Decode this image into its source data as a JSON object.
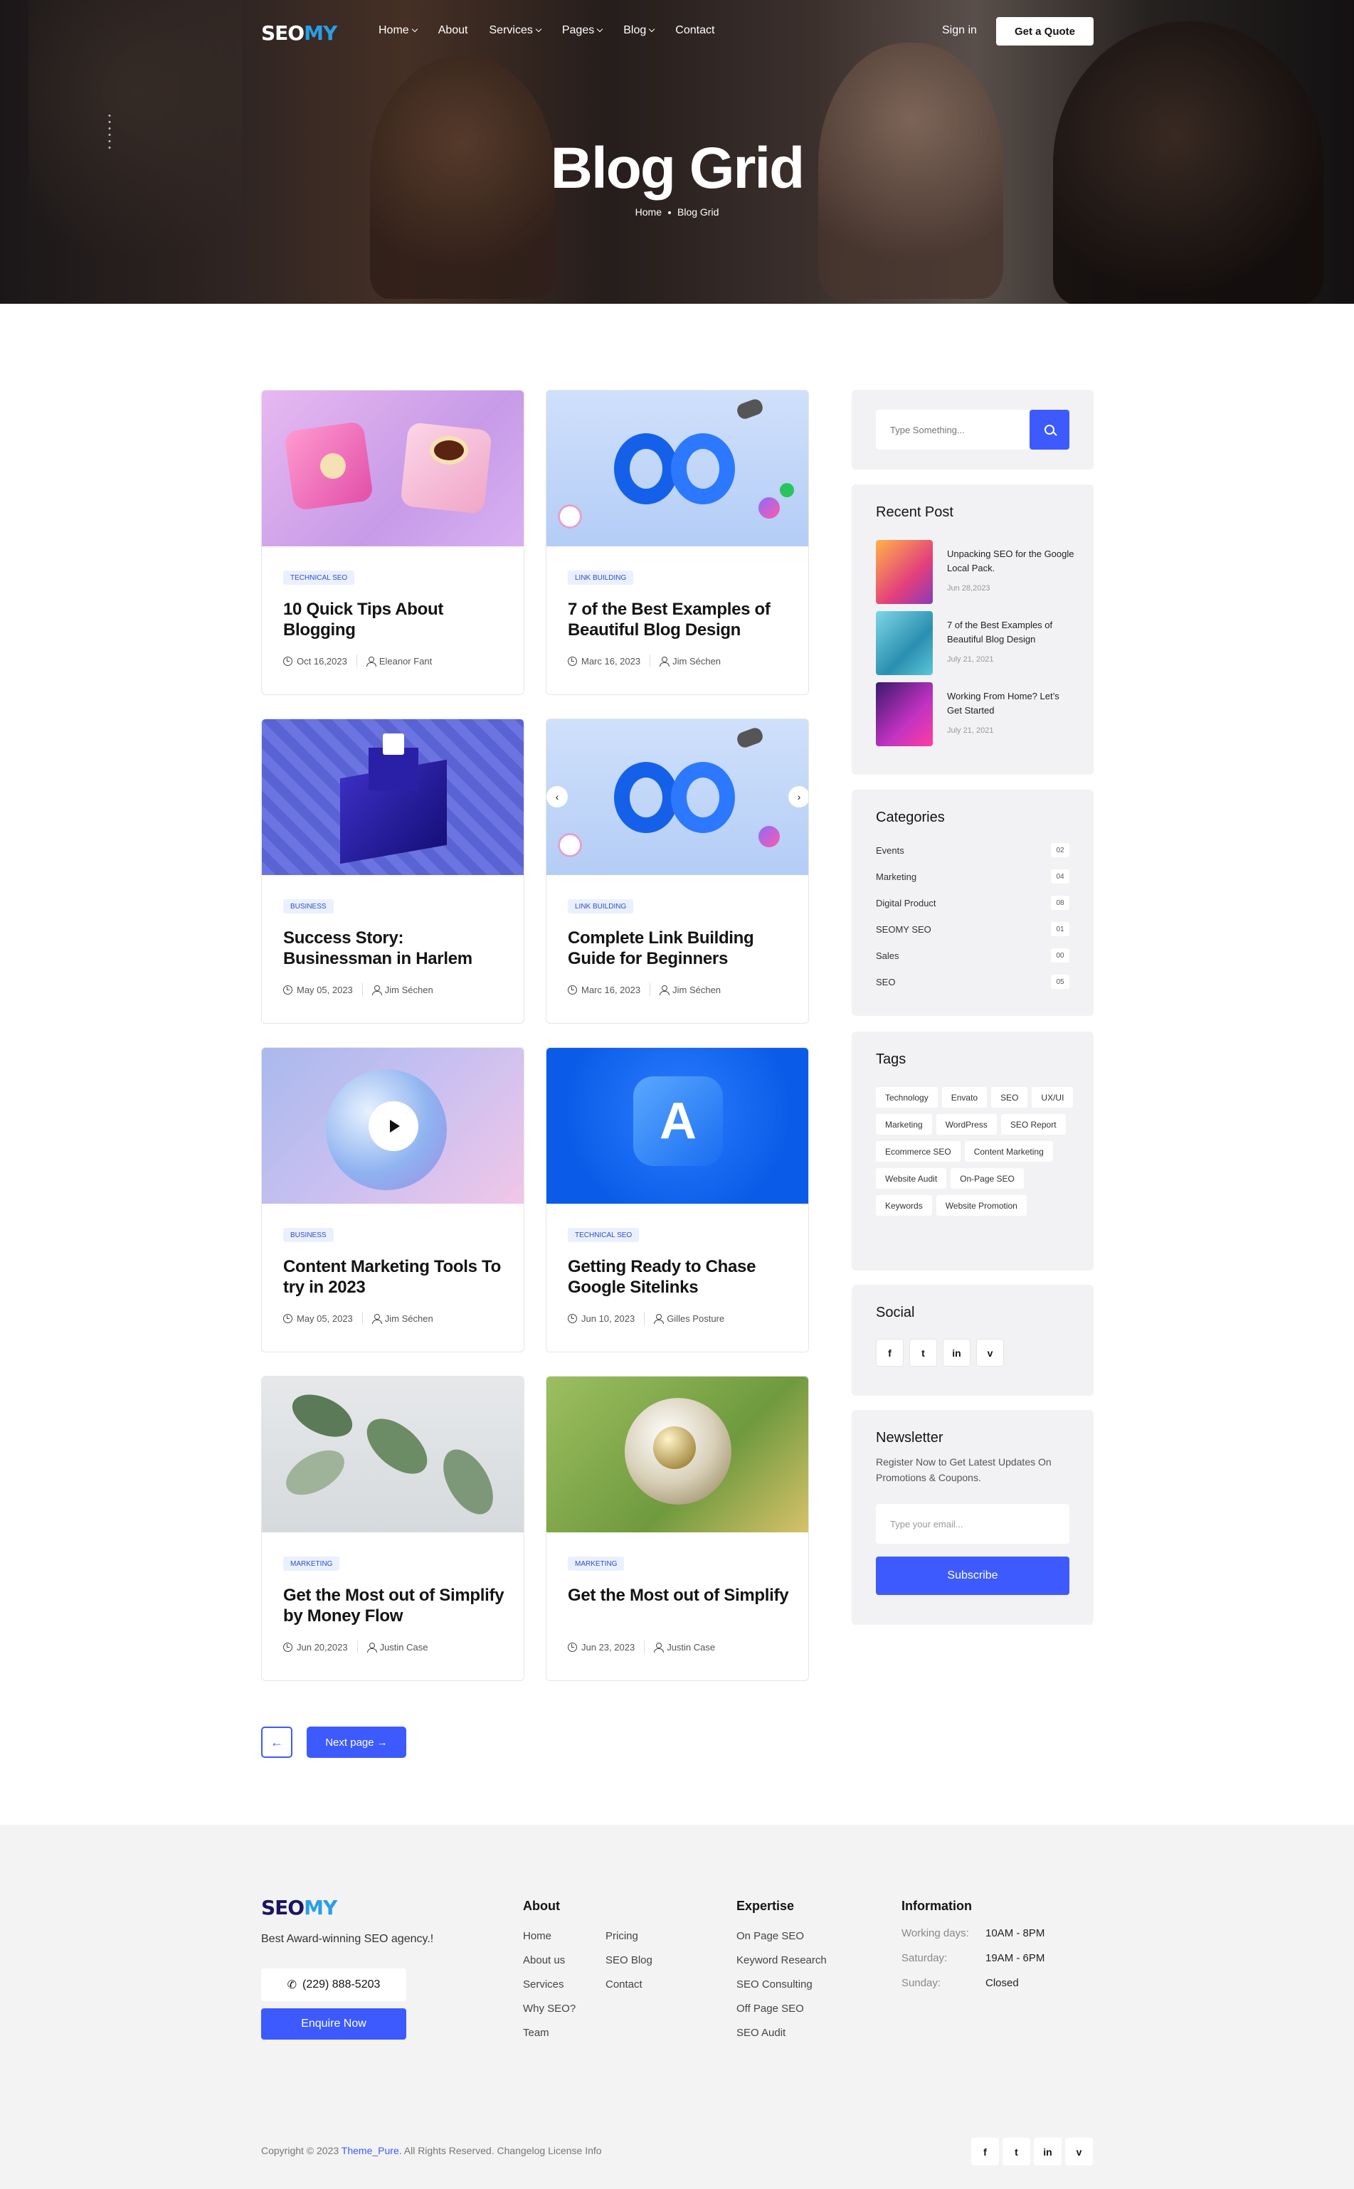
{
  "header": {
    "logo_main": "SEO",
    "logo_accent": "MY",
    "menu": [
      {
        "label": "Home",
        "dropdown": true
      },
      {
        "label": "About",
        "dropdown": false
      },
      {
        "label": "Services",
        "dropdown": true
      },
      {
        "label": "Pages",
        "dropdown": true
      },
      {
        "label": "Blog",
        "dropdown": true
      },
      {
        "label": "Contact",
        "dropdown": false
      }
    ],
    "sign_in": "Sign in",
    "quote_button": "Get a Quote"
  },
  "hero": {
    "title": "Blog Grid",
    "breadcrumb_home": "Home",
    "breadcrumb_current": "Blog Grid"
  },
  "posts": [
    {
      "tag": "TECHNICAL SEO",
      "title": "10 Quick Tips About Blogging",
      "date": "Oct 16,2023",
      "author": "Eleanor Fant",
      "image": "pink-cubes"
    },
    {
      "tag": "LINK BUILDING",
      "title": "7 of the Best Examples of Beautiful Blog Design",
      "date": "Marc 16, 2023",
      "author": "Jim Séchen",
      "image": "meta-infinity"
    },
    {
      "tag": "BUSINESS",
      "title": "Success Story: Businessman in Harlem",
      "date": "May 05, 2023",
      "author": "Jim Séchen",
      "image": "blue-blocks"
    },
    {
      "tag": "LINK BUILDING",
      "title": "Complete Link Building Guide for Beginners",
      "date": "Marc 16, 2023",
      "author": "Jim Séchen",
      "image": "meta-infinity-slider"
    },
    {
      "tag": "BUSINESS",
      "title": "Content Marketing Tools To try in 2023",
      "date": "May 05, 2023",
      "author": "Jim Séchen",
      "image": "video-sphere"
    },
    {
      "tag": "TECHNICAL SEO",
      "title": "Getting Ready to Chase Google Sitelinks",
      "date": "Jun 10, 2023",
      "author": "Gilles Posture",
      "image": "app-store"
    },
    {
      "tag": "MARKETING",
      "title": "Get the Most out of Simplify by Money Flow",
      "date": "Jun 20,2023",
      "author": "Justin Case",
      "image": "leaves"
    },
    {
      "tag": "MARKETING",
      "title": "Get the Most out of Simplify",
      "date": "Jun 23, 2023",
      "author": "Justin Case",
      "image": "gold-sphere"
    }
  ],
  "pagination": {
    "prev_icon": "arrow-left-icon",
    "next_label": "Next page →"
  },
  "sidebar": {
    "search_placeholder": "Type Something...",
    "recent_title": "Recent Post",
    "recent_posts": [
      {
        "title": "Unpacking SEO for the Google Local Pack.",
        "date": "Jun 28,2023"
      },
      {
        "title": "7 of the Best Examples of Beautiful Blog Design",
        "date": "July 21, 2021"
      },
      {
        "title": "Working From Home? Let’s Get Started",
        "date": "July 21, 2021"
      }
    ],
    "categories_title": "Categories",
    "categories": [
      {
        "name": "Events",
        "count": "02"
      },
      {
        "name": "Marketing",
        "count": "04"
      },
      {
        "name": "Digital Product",
        "count": "08"
      },
      {
        "name": "SEOMY SEO",
        "count": "01"
      },
      {
        "name": "Sales",
        "count": "00"
      },
      {
        "name": "SEO",
        "count": "05"
      }
    ],
    "tags_title": "Tags",
    "tags": [
      "Technology",
      "Envato",
      "SEO",
      "UX/UI",
      "Marketing",
      "WordPress",
      "SEO Report",
      "Ecommerce SEO",
      "Content Marketing",
      "Website Audit",
      "On-Page SEO",
      "Keywords",
      "Website Promotion"
    ],
    "social_title": "Social",
    "social": [
      "f",
      "t",
      "in",
      "v"
    ],
    "newsletter_title": "Newsletter",
    "newsletter_text": "Register Now to Get Latest Updates On Promotions & Coupons.",
    "newsletter_placeholder": "Type your email...",
    "subscribe_label": "Subscribe"
  },
  "footer": {
    "logo_main": "SEO",
    "logo_accent": "MY",
    "tagline": "Best Award-winning SEO agency.!",
    "phone": "(229) 888-5203",
    "enquire_label": "Enquire Now",
    "about_title": "About",
    "about_col1": [
      "Home",
      "About us",
      "Services",
      "Why SEO?",
      "Team"
    ],
    "about_col2": [
      "Pricing",
      "SEO Blog",
      "Contact"
    ],
    "expertise_title": "Expertise",
    "expertise": [
      "On Page SEO",
      "Keyword Research",
      "SEO Consulting",
      "Off Page SEO",
      "SEO Audit"
    ],
    "info_title": "Information",
    "info": [
      {
        "label": "Working days:",
        "value": "10AM - 8PM"
      },
      {
        "label": "Saturday:",
        "value": "19AM - 6PM"
      },
      {
        "label": "Sunday:",
        "value": "Closed"
      }
    ],
    "copyright_prefix": "Copyright © 2023",
    "copyright_brand": "Theme_Pure.",
    "copyright_suffix": "All Rights Reserved. Changelog License Info",
    "social": [
      "f",
      "t",
      "in",
      "v"
    ]
  },
  "colors": {
    "accent": "#3d5afe",
    "tag_bg": "#eaf0ff",
    "sidebar_bg": "#f2f2f4",
    "footer_bg": "#f3f3f4"
  }
}
